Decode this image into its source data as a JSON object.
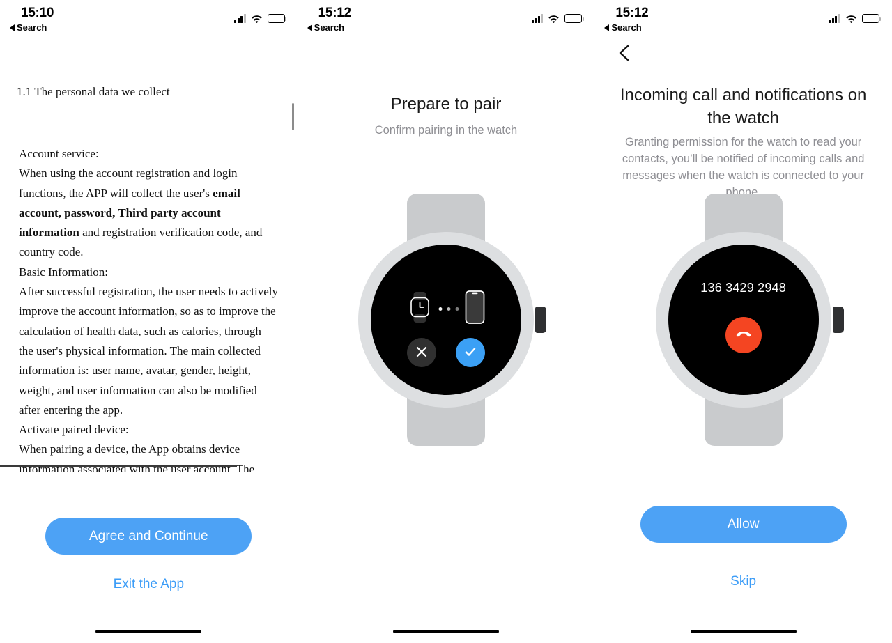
{
  "screens": [
    {
      "id": "privacy-policy",
      "statusbar": {
        "time": "15:10",
        "back_label": "Search"
      },
      "document": {
        "heading": "1.1 The personal data we collect",
        "section1_label": "Account service:",
        "section1_p1": "When using the account registration and login functions, the APP will collect the user's ",
        "section1_bold": "email account, password, Third party account information",
        "section1_p2": "  and registration verification code, and country code.",
        "section2_label": "Basic Information:",
        "section2_p": "After successful registration, the user needs to actively improve the account information, so as to improve the calculation of health data, such as calories, through the user's physical information. The main collected information is: user name, avatar, gender, height, weight, and user information can also be modified after entering the app.",
        "section3_label": "Activate paired device:",
        "section3_p": "When pairing a device, the App obtains device information associated with the user account. The"
      },
      "primary_button": "Agree and Continue",
      "secondary_link": "Exit the App"
    },
    {
      "id": "prepare-to-pair",
      "statusbar": {
        "time": "15:12",
        "back_label": "Search"
      },
      "title": "Prepare to pair",
      "subtitle": "Confirm pairing in the watch",
      "watch_face": {
        "type": "pairing",
        "deny_icon": "close-icon",
        "accept_icon": "check-icon",
        "watch_icon": "watch-icon",
        "phone_icon": "phone-icon",
        "dots": 3
      }
    },
    {
      "id": "contacts-permission",
      "statusbar": {
        "time": "15:12",
        "back_label": "Search"
      },
      "back_icon": "chevron-left-icon",
      "title": "Incoming call and notifications on the watch",
      "subtitle": "Granting permission for the watch to read your contacts, you’ll be notified of incoming calls and messages when the watch is connected to your phone.",
      "watch_face": {
        "type": "incoming-call",
        "caller_number": "136 3429 2948",
        "hangup_icon": "phone-hangup-icon"
      },
      "primary_button": "Allow",
      "secondary_link": "Skip"
    }
  ],
  "colors": {
    "accent_blue": "#4da2f5",
    "link_blue": "#3b9cf7",
    "hangup_red": "#f44522",
    "watch_band": "#c9cbcd",
    "watch_case": "#dddfe1",
    "subtitle_grey": "#8e8e93"
  }
}
